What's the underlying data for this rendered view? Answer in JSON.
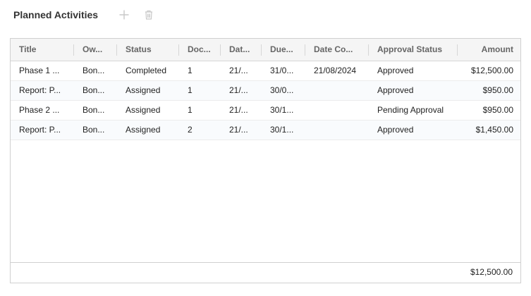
{
  "panel": {
    "title": "Planned Activities",
    "add_icon": "plus-icon",
    "delete_icon": "trash-icon"
  },
  "columns": [
    "Title",
    "Ow...",
    "Status",
    "Doc...",
    "Dat...",
    "Due...",
    "Date Co...",
    "Approval Status",
    "Amount"
  ],
  "rows": [
    [
      "Phase 1 ...",
      "Bon...",
      "Completed",
      "1",
      "21/...",
      "31/0...",
      "21/08/2024",
      "Approved",
      "$12,500.00"
    ],
    [
      "Report: P...",
      "Bon...",
      "Assigned",
      "1",
      "21/...",
      "30/0...",
      "",
      "Approved",
      "$950.00"
    ],
    [
      "Phase 2 ...",
      "Bon...",
      "Assigned",
      "1",
      "21/...",
      "30/1...",
      "",
      "Pending Approval",
      "$950.00"
    ],
    [
      "Report: P...",
      "Bon...",
      "Assigned",
      "2",
      "21/...",
      "30/1...",
      "",
      "Approved",
      "$1,450.00"
    ]
  ],
  "footer": {
    "total": "$12,500.00"
  },
  "colors": {
    "header_bg": "#f5f5f5",
    "border": "#d0d0d0",
    "icon": "#c8c8c8"
  }
}
